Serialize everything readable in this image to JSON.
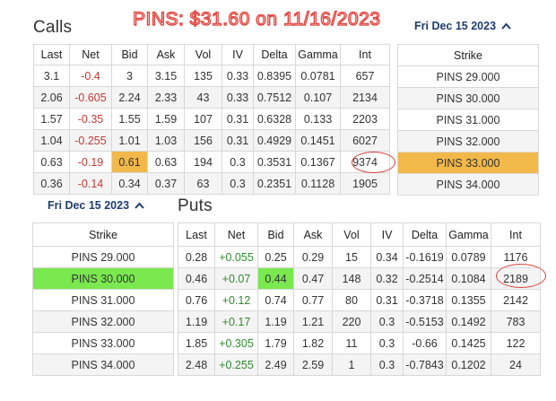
{
  "calls": {
    "title": "Calls",
    "columns": [
      "Last",
      "Net",
      "Bid",
      "Ask",
      "Vol",
      "IV",
      "Delta",
      "Gamma",
      "Int"
    ],
    "rows": [
      [
        "3.1",
        "-0.4",
        "3",
        "3.15",
        "135",
        "0.33",
        "0.8395",
        "0.0781",
        "657"
      ],
      [
        "2.06",
        "-0.605",
        "2.24",
        "2.33",
        "43",
        "0.33",
        "0.7512",
        "0.107",
        "2134"
      ],
      [
        "1.57",
        "-0.35",
        "1.55",
        "1.59",
        "107",
        "0.31",
        "0.6328",
        "0.133",
        "2203"
      ],
      [
        "1.04",
        "-0.255",
        "1.01",
        "1.03",
        "156",
        "0.31",
        "0.4929",
        "0.1451",
        "6027"
      ],
      [
        "0.63",
        "-0.19",
        "0.61",
        "0.63",
        "194",
        "0.3",
        "0.3531",
        "0.1367",
        "9374"
      ],
      [
        "0.36",
        "-0.14",
        "0.34",
        "0.37",
        "63",
        "0.3",
        "0.2351",
        "0.1128",
        "1905"
      ]
    ]
  },
  "banner": "PINS: $31.60 on 11/16/2023",
  "calls_expiry": {
    "label": "Fri Dec 15 2023",
    "icon": "chevron-up-icon"
  },
  "calls_strikes": {
    "header": "Strike",
    "items": [
      "PINS 29.000",
      "PINS 30.000",
      "PINS 31.000",
      "PINS 32.000",
      "PINS 33.000",
      "PINS 34.000"
    ]
  },
  "puts_expiry": {
    "label": "Fri Dec 15 2023",
    "icon": "chevron-up-icon"
  },
  "puts_strikes": {
    "header": "Strike",
    "items": [
      "PINS 29.000",
      "PINS 30.000",
      "PINS 31.000",
      "PINS 32.000",
      "PINS 33.000",
      "PINS 34.000"
    ]
  },
  "puts": {
    "title": "Puts",
    "columns": [
      "Last",
      "Net",
      "Bid",
      "Ask",
      "Vol",
      "IV",
      "Delta",
      "Gamma",
      "Int"
    ],
    "rows": [
      [
        "0.28",
        "+0.055",
        "0.25",
        "0.29",
        "15",
        "0.34",
        "-0.1619",
        "0.0789",
        "1176"
      ],
      [
        "0.46",
        "+0.07",
        "0.44",
        "0.47",
        "148",
        "0.32",
        "-0.2514",
        "0.1084",
        "2189"
      ],
      [
        "0.76",
        "+0.12",
        "0.74",
        "0.77",
        "80",
        "0.31",
        "-0.3718",
        "0.1355",
        "2142"
      ],
      [
        "1.19",
        "+0.17",
        "1.19",
        "1.21",
        "220",
        "0.3",
        "-0.5153",
        "0.1492",
        "783"
      ],
      [
        "1.85",
        "+0.305",
        "1.79",
        "1.82",
        "11",
        "0.3",
        "-0.66",
        "0.1425",
        "122"
      ],
      [
        "2.48",
        "+0.255",
        "2.49",
        "2.59",
        "1",
        "0.3",
        "-0.7843",
        "0.1202",
        "24"
      ]
    ]
  },
  "colors": {
    "highlight_orange": "#f2b84a",
    "highlight_green": "#7ae84f",
    "negative": "#c23a33",
    "positive": "#2e8b2e",
    "annotation": "#d9443e",
    "date_link": "#1f3c6d"
  }
}
